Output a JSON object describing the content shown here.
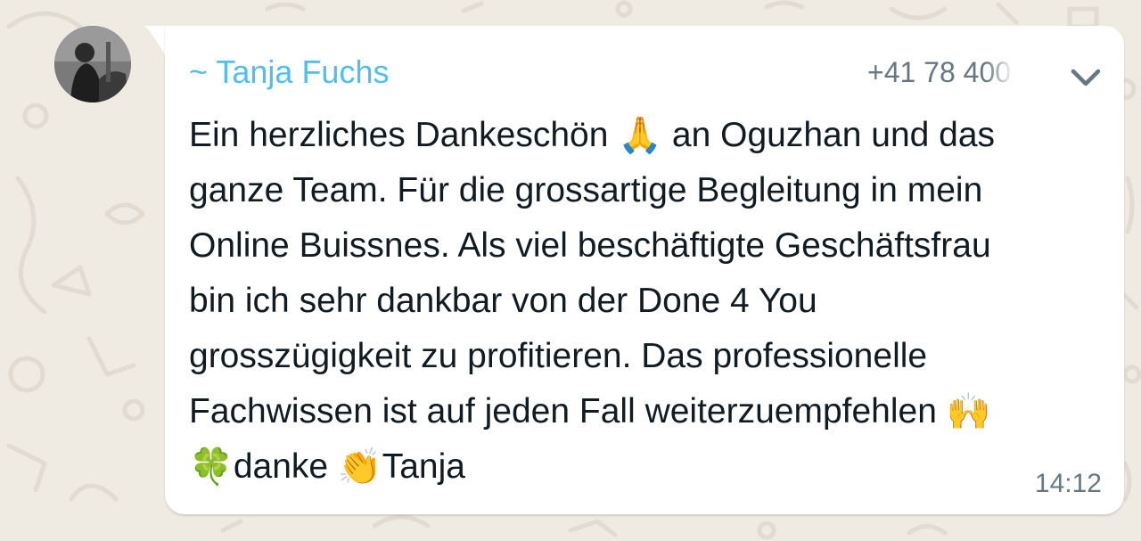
{
  "chat": {
    "background_color": "#efeae2",
    "bubble_color": "#ffffff"
  },
  "message": {
    "sender_name": "~ Tanja Fuchs",
    "sender_name_color": "#53bdeb",
    "sender_phone": "+41 78 400 ",
    "menu_icon": "chevron-down-icon",
    "avatar_icon": "avatar-photo",
    "lines": [
      [
        "Ein herzliches Dankeschön ",
        "🙏",
        " an Oguzhan und das"
      ],
      [
        "ganze Team. Für die grossartige Begleitung in mein"
      ],
      [
        "Online Buissnes. Als viel beschäftigte Geschäftsfrau"
      ],
      [
        "bin ich sehr dankbar von der Done 4 You"
      ],
      [
        "grosszügigkeit zu profitieren. Das professionelle"
      ],
      [
        "Fachwissen ist auf jeden Fall weiterzuempfehlen ",
        "🙌"
      ],
      [
        "🍀",
        "danke ",
        "👏",
        "Tanja"
      ]
    ],
    "time": "14:12"
  }
}
